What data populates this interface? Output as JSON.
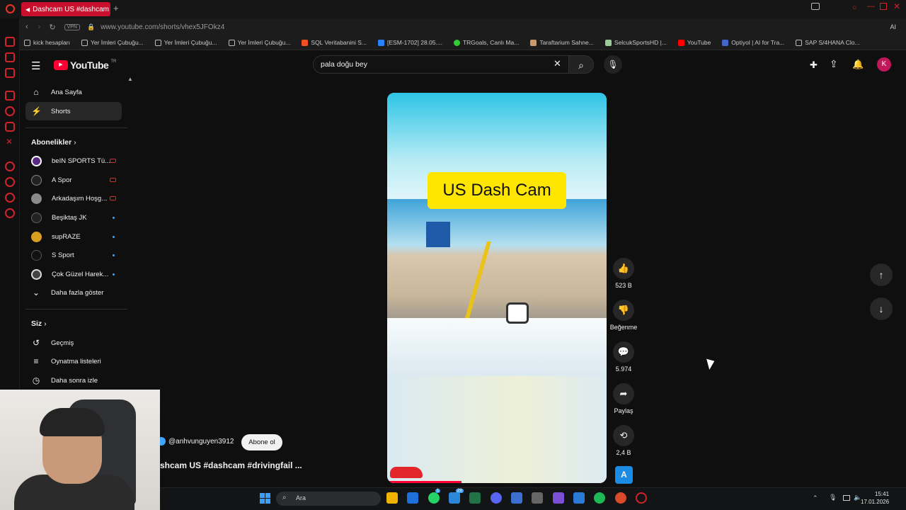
{
  "browser": {
    "tab_title": "Dashcam US #dashcam",
    "new_tab": "+",
    "url": "www.youtube.com/shorts/vhex5JFOkz4",
    "vpn": "VPN",
    "ai_label": "AI",
    "bookmarks": [
      "kick hesapları",
      "Yer İmleri Çubuğu...",
      "Yer İmleri Çubuğu...",
      "Yer İmleri Çubuğu...",
      "SQL Veritabanini S...",
      "[ESM-1702] 28.05....",
      "TRGoals, Canlı Ma...",
      "Taraftarium Sahne...",
      "SelcukSportsHD |...",
      "YouTube",
      "Optiyol | AI for Tra...",
      "SAP S/4HANA Clo..."
    ]
  },
  "header": {
    "logo": "YouTube",
    "logo_region": "TR",
    "search_value": "pala doğu bey",
    "avatar_letter": "K"
  },
  "sidebar": {
    "home": "Ana Sayfa",
    "shorts": "Shorts",
    "subscriptions_head": "Abonelikler",
    "channels": [
      {
        "name": "beIN SPORTS Tü...",
        "status": "live"
      },
      {
        "name": "A Spor",
        "status": "live"
      },
      {
        "name": "Arkadaşım Hoşg...",
        "status": "live"
      },
      {
        "name": "Beşiktaş JK",
        "status": "new"
      },
      {
        "name": "supRAZE",
        "status": "new"
      },
      {
        "name": "S Sport",
        "status": "new"
      },
      {
        "name": "Çok Güzel Harek...",
        "status": "new"
      }
    ],
    "show_more": "Daha fazla göster",
    "you_head": "Siz",
    "history": "Geçmiş",
    "playlists": "Oynatma listeleri",
    "watch_later": "Daha sonra izle"
  },
  "video": {
    "overlay_title": "US Dash Cam",
    "progress": 0.34,
    "channel": "@anhvunguyen3912",
    "subscribe": "Abone ol",
    "title": "shcam US #dashcam #drivingfail ..."
  },
  "actions": {
    "likes": "523 B",
    "dislike": "Beğenme",
    "comments": "5.974",
    "share": "Paylaş",
    "remix": "2,4 B",
    "sound_badge": "A"
  },
  "taskbar": {
    "search": "Ara",
    "time": "15:41",
    "date": "17.01.2026",
    "badge_whatsapp": "1",
    "badge_app": "29"
  },
  "colors": {
    "yt_red": "#ff0033",
    "opera_red": "#c8102e",
    "accent_blue": "#3ea6ff",
    "overlay_yellow": "#ffe600"
  }
}
